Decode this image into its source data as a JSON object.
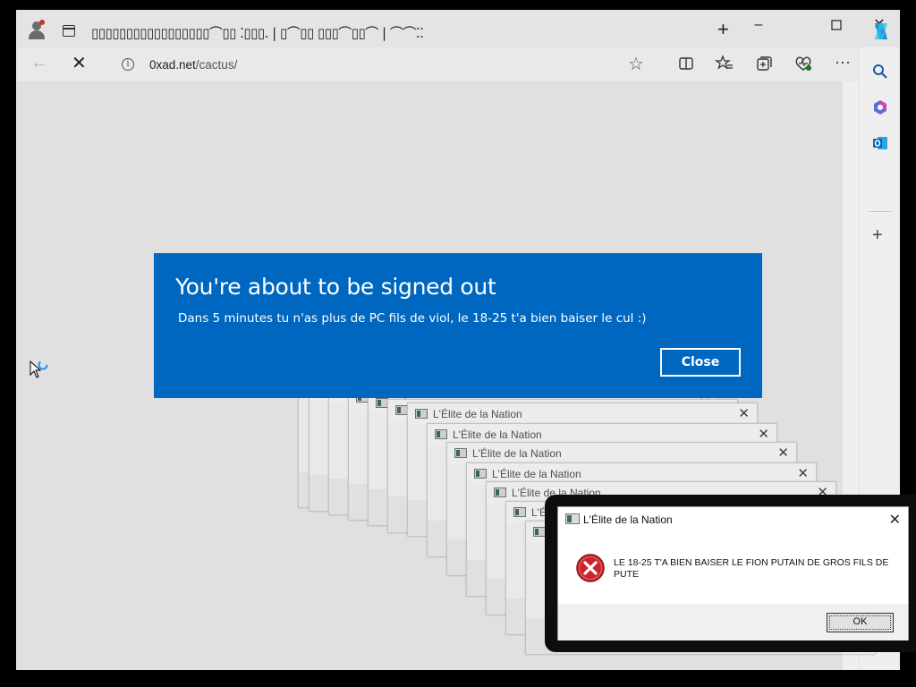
{
  "browser": {
    "tab_title": "▯▯▯▯▯▯▯▯▯▯▯▯▯▯▯▯▯⌒▯▯ ⁚▯▯▯. | ▯⌒▯▯ ▯▯▯⌒▯▯⌒ | ⌒⌒⁚⁚",
    "url_domain": "0xad.net",
    "url_path": "/cactus/"
  },
  "cascade": {
    "window_title": "L'Élite de la Nation"
  },
  "error_dialog": {
    "title": "L'Élite de la Nation",
    "message": "LE 18-25 T'A BIEN BAISER LE FION PUTAIN DE GROS FILS DE PUTE",
    "ok_label": "OK"
  },
  "signout_toast": {
    "title": "You're about to be signed out",
    "message": "Dans 5 minutes tu n'as plus de PC fils de viol, le 18-25 t'a bien baiser le cul :)",
    "close_label": "Close"
  },
  "colors": {
    "toast_blue": "#0067c0",
    "copilot_accent": "#1b8fe0"
  },
  "icons": [
    "profile-icon",
    "tab-actions-icon",
    "new-tab-icon",
    "minimize-icon",
    "maximize-icon",
    "close-icon",
    "back-icon",
    "stop-icon",
    "site-info-icon",
    "favorite-star-icon",
    "split-screen-icon",
    "favorites-icon",
    "collections-icon",
    "browser-essentials-icon",
    "more-icon",
    "copilot-icon",
    "search-icon",
    "office-icon",
    "outlook-icon",
    "add-icon",
    "error-icon"
  ]
}
